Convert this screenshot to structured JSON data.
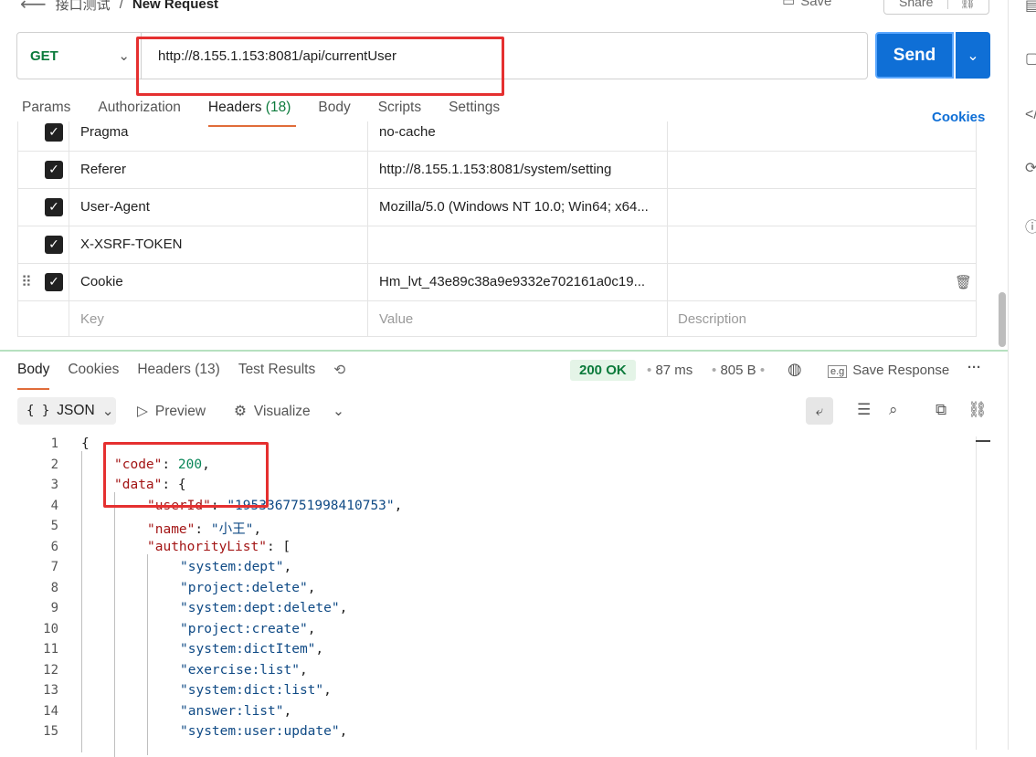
{
  "topbar": {
    "breadcrumb_parent": "接口测试",
    "breadcrumb_sep": "/",
    "title": "New Request",
    "save_label": "Save",
    "share_label": "Share"
  },
  "request": {
    "method": "GET",
    "url": "http://8.155.1.153:8081/api/currentUser",
    "send_label": "Send",
    "tabs": [
      {
        "label": "Params"
      },
      {
        "label": "Authorization"
      },
      {
        "label": "Headers",
        "count": "(18)"
      },
      {
        "label": "Body"
      },
      {
        "label": "Scripts"
      },
      {
        "label": "Settings"
      }
    ],
    "cookies_link": "Cookies"
  },
  "headers_table": {
    "rows": [
      {
        "key": "Pragma",
        "value": "no-cache",
        "checked": true
      },
      {
        "key": "Referer",
        "value": "http://8.155.1.153:8081/system/setting",
        "checked": true
      },
      {
        "key": "User-Agent",
        "value": "Mozilla/5.0 (Windows NT 10.0; Win64; x64...",
        "checked": true
      },
      {
        "key": "X-XSRF-TOKEN",
        "value": "",
        "checked": true
      },
      {
        "key": "Cookie",
        "value": "Hm_lvt_43e89c38a9e9332e702161a0c19...",
        "checked": true
      }
    ],
    "placeholders": {
      "key": "Key",
      "value": "Value",
      "description": "Description"
    }
  },
  "response": {
    "tabs": [
      {
        "label": "Body"
      },
      {
        "label": "Cookies"
      },
      {
        "label": "Headers (13)"
      },
      {
        "label": "Test Results"
      }
    ],
    "status": "200 OK",
    "time": "87 ms",
    "size": "805 B",
    "save_response": "Save Response",
    "format": "JSON",
    "preview_label": "Preview",
    "visualize_label": "Visualize",
    "json": {
      "code_key": "\"code\"",
      "code_val": "200",
      "data_key": "\"data\"",
      "userId_key": "\"userId\"",
      "userId_val": "\"1953367751998410753\"",
      "name_key": "\"name\"",
      "name_val": "\"小王\"",
      "authority_key": "\"authorityList\"",
      "authorities": [
        "\"system:dept\"",
        "\"project:delete\"",
        "\"system:dept:delete\"",
        "\"project:create\"",
        "\"system:dictItem\"",
        "\"exercise:list\"",
        "\"system:dict:list\"",
        "\"answer:list\"",
        "\"system:user:update\""
      ]
    },
    "line_numbers": [
      "1",
      "2",
      "3",
      "4",
      "5",
      "6",
      "7",
      "8",
      "9",
      "10",
      "11",
      "12",
      "13",
      "14",
      "15"
    ]
  },
  "colors": {
    "accent": "#0f6fd6",
    "status_green": "#0b7a3b",
    "annotation_red": "#e53030",
    "tab_underline": "#e06c3a"
  },
  "icons": [
    "back-arrow-icon",
    "save-icon",
    "history-icon",
    "chevron-down-icon",
    "drag-handle-icon",
    "trash-icon",
    "globe-icon",
    "example-icon",
    "more-icon",
    "wrap-icon",
    "filter-icon",
    "search-icon",
    "copy-icon",
    "link-icon",
    "preview-icon",
    "visualize-icon",
    "braces-icon"
  ]
}
